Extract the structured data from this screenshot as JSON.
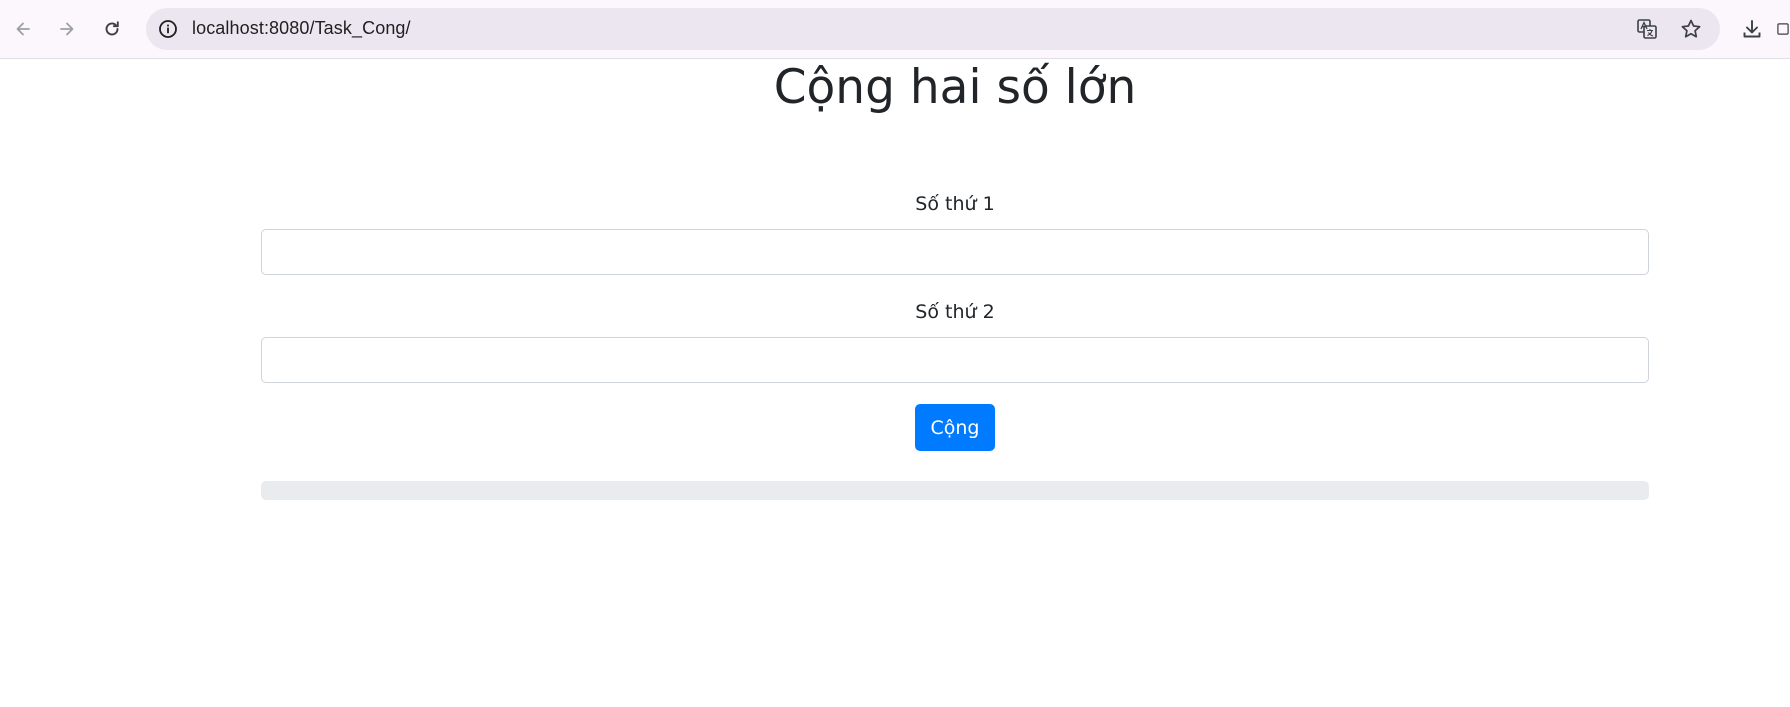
{
  "browser": {
    "url": "localhost:8080/Task_Cong/"
  },
  "page": {
    "title": "Cộng hai số lớn",
    "field1": {
      "label": "Số thứ 1",
      "value": "",
      "placeholder": ""
    },
    "field2": {
      "label": "Số thứ 2",
      "value": "",
      "placeholder": ""
    },
    "submit_label": "Cộng",
    "result": ""
  },
  "colors": {
    "primary_button": "#007bff",
    "result_background": "#e9ecef",
    "toolbar_background": "#fcf7fd",
    "omnibox_background": "#ece6f0"
  }
}
